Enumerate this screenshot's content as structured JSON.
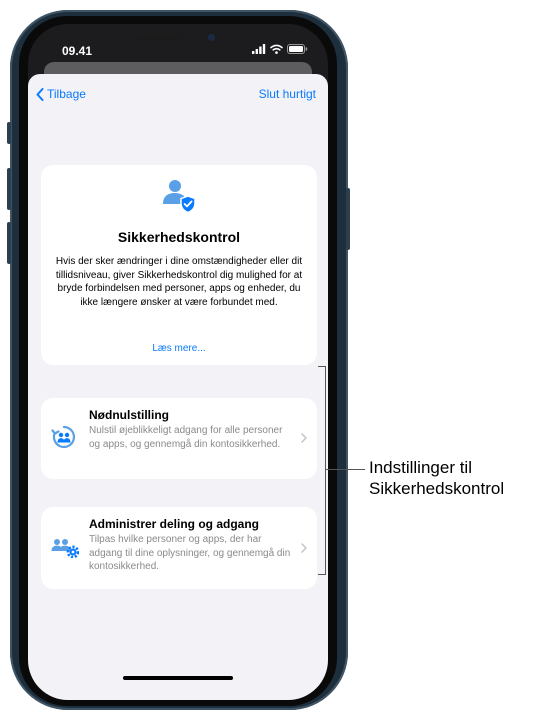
{
  "status_bar": {
    "time": "09.41"
  },
  "nav": {
    "back_label": "Tilbage",
    "quit_label": "Slut hurtigt"
  },
  "intro_card": {
    "title": "Sikkerhedskontrol",
    "description": "Hvis der sker ændringer i dine omstændigheder eller dit tillidsniveau, giver Sikkerhedskontrol dig mulighed for at bryde forbindelsen med personer, apps og enheder, du ikke længere ønsker at være forbundet med.",
    "link": "Læs mere..."
  },
  "options": [
    {
      "title": "Nødnulstilling",
      "description": "Nulstil øjeblikkeligt adgang for alle personer og apps, og gennemgå din kontosikkerhed."
    },
    {
      "title": "Administrer deling og adgang",
      "description": "Tilpas hvilke personer og apps, der har adgang til dine oplysninger, og gennemgå din kontosikkerhed."
    }
  ],
  "annotation": {
    "label": "Indstillinger til Sikkerhedskontrol"
  },
  "colors": {
    "accent": "#0a7aff",
    "icon_blue": "#5aa0e6",
    "sheet_bg": "#f2f2f7",
    "secondary_text": "#8a8a8e"
  },
  "icons": [
    "chevron-left-icon",
    "person-shield-icon",
    "emergency-reset-icon",
    "people-gear-icon",
    "chevron-right-icon",
    "signal-icon",
    "wifi-icon",
    "battery-icon"
  ]
}
